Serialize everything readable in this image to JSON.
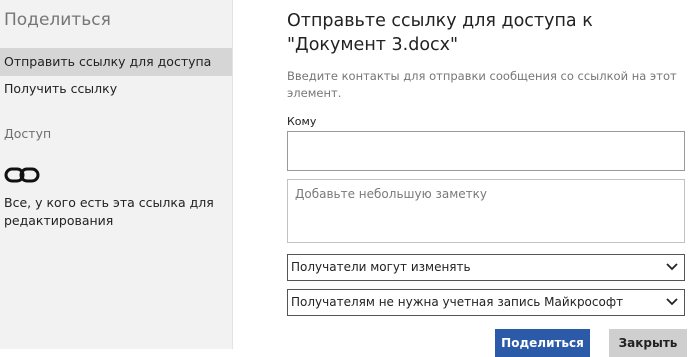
{
  "sidebar": {
    "title": "Поделиться",
    "items": [
      {
        "label": "Отправить ссылку для доступа"
      },
      {
        "label": "Получить ссылку"
      }
    ],
    "section": "Доступ",
    "access_icon": "link-icon",
    "access_description": "Все, у кого есть эта ссылка для редактирования"
  },
  "main": {
    "heading": "Отправьте ссылку для доступа к \"Документ 3.docx\"",
    "hint": "Введите контакты для отправки сообщения со ссылкой на этот элемент.",
    "to_label": "Кому",
    "to_value": "",
    "note_placeholder": "Добавьте небольшую заметку",
    "permission_select": "Получатели могут изменять",
    "account_select": "Получателям не нужна учетная запись Майкрософт",
    "share_button": "Поделиться",
    "close_button": "Закрыть"
  },
  "colors": {
    "accent": "#2a5aa8",
    "sidebar_bg": "#f2f2f2",
    "selected_item_bg": "#d6d6d6"
  }
}
